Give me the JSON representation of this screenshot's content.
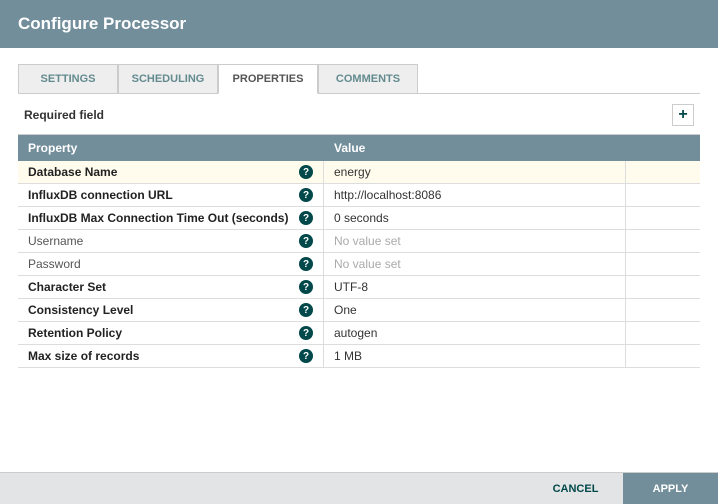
{
  "header": {
    "title": "Configure Processor"
  },
  "tabs": [
    {
      "label": "SETTINGS",
      "active": false
    },
    {
      "label": "SCHEDULING",
      "active": false
    },
    {
      "label": "PROPERTIES",
      "active": true
    },
    {
      "label": "COMMENTS",
      "active": false
    }
  ],
  "subheader": {
    "label": "Required field"
  },
  "columns": {
    "property": "Property",
    "value": "Value"
  },
  "properties": [
    {
      "name": "Database Name",
      "required": true,
      "value": "energy",
      "placeholder": false,
      "selected": true
    },
    {
      "name": "InfluxDB connection URL",
      "required": true,
      "value": "http://localhost:8086",
      "placeholder": false,
      "selected": false
    },
    {
      "name": "InfluxDB Max Connection Time Out (seconds)",
      "required": true,
      "value": "0 seconds",
      "placeholder": false,
      "selected": false
    },
    {
      "name": "Username",
      "required": false,
      "value": "No value set",
      "placeholder": true,
      "selected": false
    },
    {
      "name": "Password",
      "required": false,
      "value": "No value set",
      "placeholder": true,
      "selected": false
    },
    {
      "name": "Character Set",
      "required": true,
      "value": "UTF-8",
      "placeholder": false,
      "selected": false
    },
    {
      "name": "Consistency Level",
      "required": true,
      "value": "One",
      "placeholder": false,
      "selected": false
    },
    {
      "name": "Retention Policy",
      "required": true,
      "value": "autogen",
      "placeholder": false,
      "selected": false
    },
    {
      "name": "Max size of records",
      "required": true,
      "value": "1 MB",
      "placeholder": false,
      "selected": false
    }
  ],
  "footer": {
    "cancel": "CANCEL",
    "apply": "APPLY"
  }
}
